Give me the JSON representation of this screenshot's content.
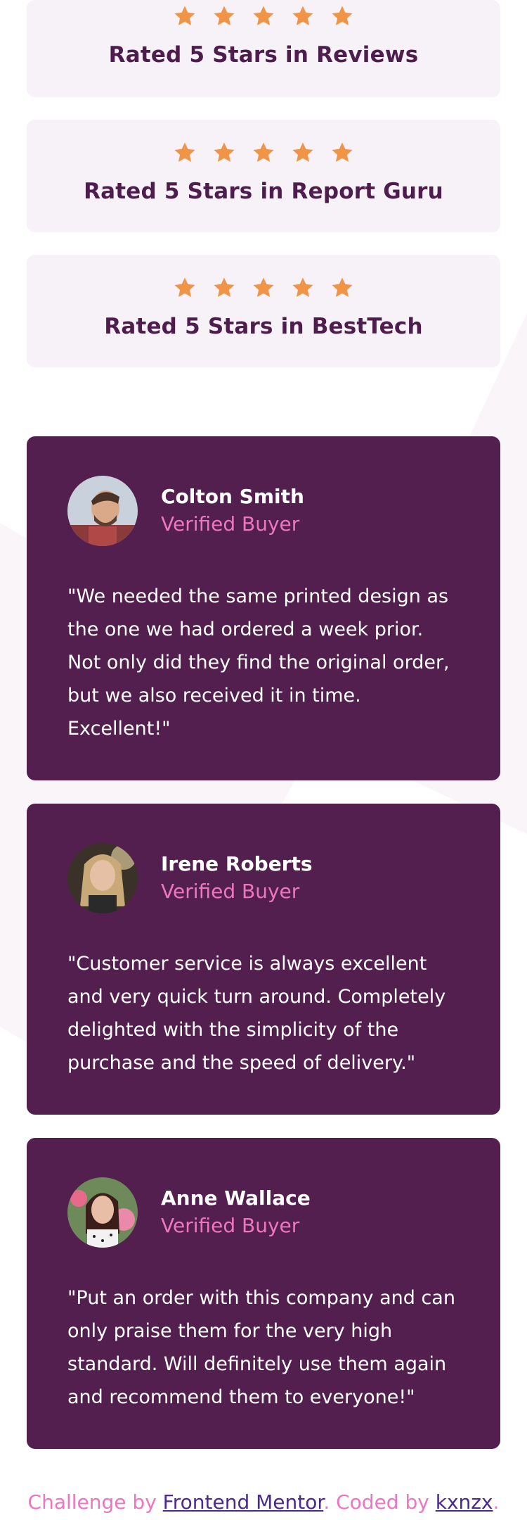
{
  "colors": {
    "star": "#f09448",
    "rating_bg": "#f7f2f7",
    "rating_text": "#4e1d4e",
    "card_bg": "#521f4e",
    "accent_pink": "#ee76c0",
    "link": "#4a2a8c"
  },
  "ratings": [
    {
      "title": "Rated 5 Stars in Reviews",
      "stars": 5
    },
    {
      "title": "Rated 5 Stars in Report Guru",
      "stars": 5
    },
    {
      "title": "Rated 5 Stars in BestTech",
      "stars": 5
    }
  ],
  "testimonials": [
    {
      "name": "Colton Smith",
      "role": "Verified Buyer",
      "quote": "\"We needed the same printed design as the one we had ordered a week prior. Not only did they find the original order, but we also received it in time. Excellent!\""
    },
    {
      "name": "Irene Roberts",
      "role": "Verified Buyer",
      "quote": "\"Customer service is always excellent and very quick turn around. Completely delighted with the simplicity of the purchase and the speed of delivery.\""
    },
    {
      "name": "Anne Wallace",
      "role": "Verified Buyer",
      "quote": "\"Put an order with this company and can only praise them for the very high standard. Will definitely use them again and recommend them to everyone!\""
    }
  ],
  "footer": {
    "prefix": "Challenge by ",
    "link1": "Frontend Mentor",
    "middle": ". Coded by ",
    "link2": "kxnzx",
    "suffix": "."
  }
}
